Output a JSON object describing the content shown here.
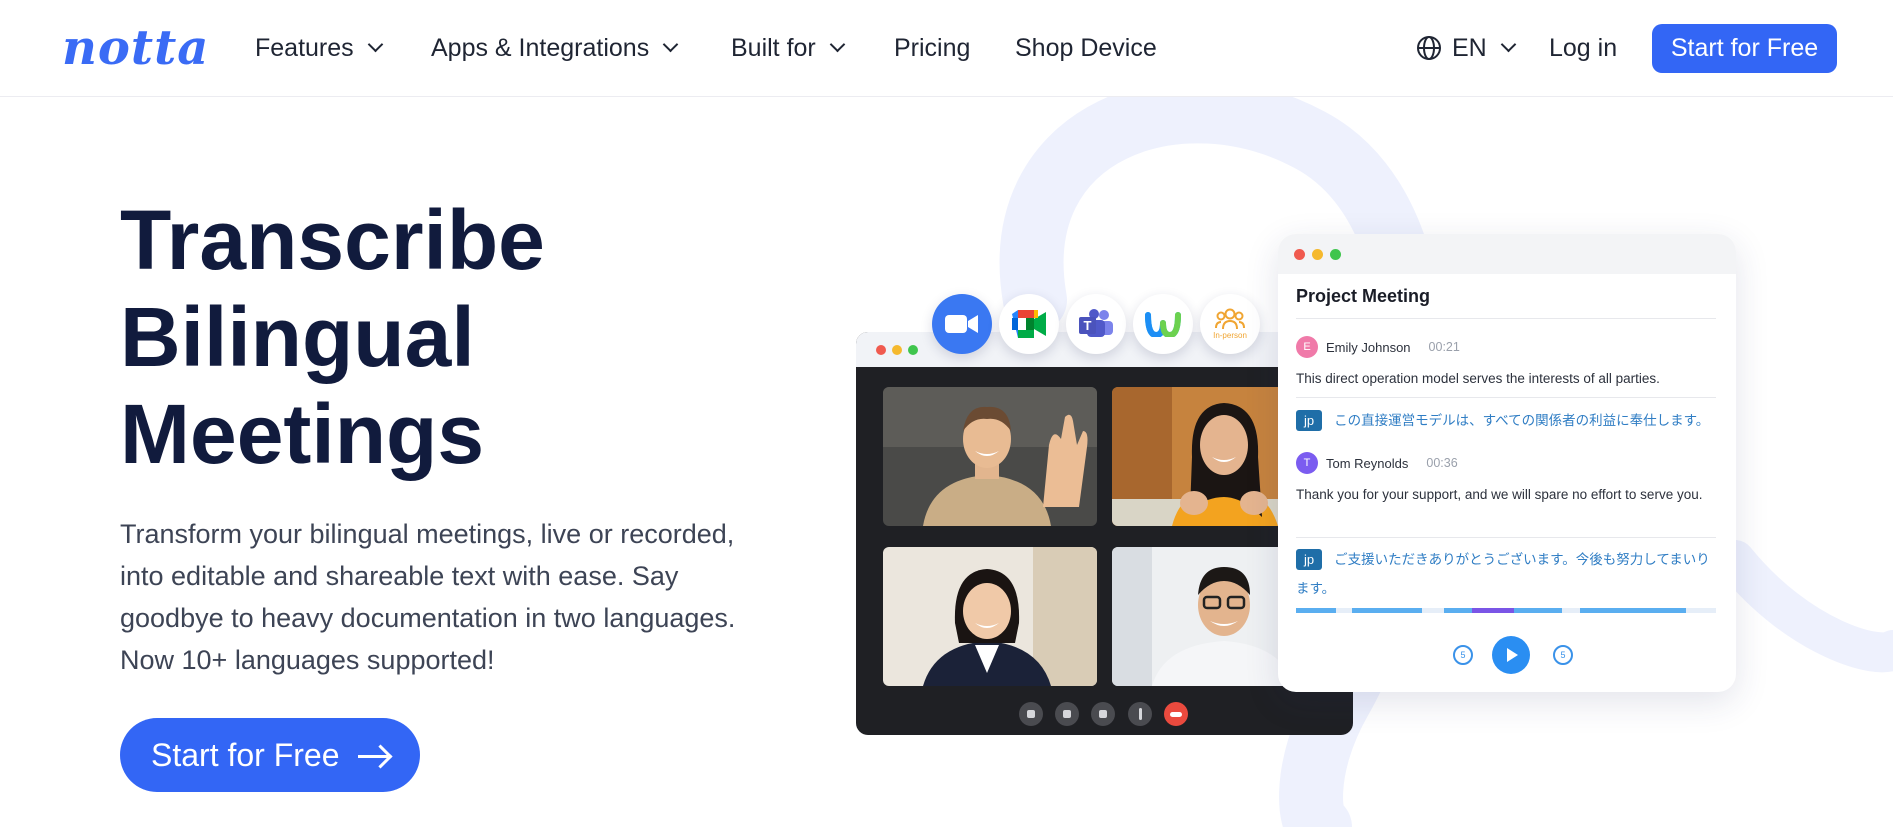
{
  "nav": {
    "logo": "notta",
    "items": [
      {
        "label": "Features",
        "dropdown": true
      },
      {
        "label": "Apps & Integrations",
        "dropdown": true
      },
      {
        "label": "Built for",
        "dropdown": true
      },
      {
        "label": "Pricing",
        "dropdown": false
      },
      {
        "label": "Shop Device",
        "dropdown": false
      }
    ],
    "language": "EN",
    "login": "Log in",
    "cta": "Start for Free"
  },
  "hero": {
    "title_lines": [
      "Transcribe",
      "Bilingual",
      "Meetings"
    ],
    "description": "Transform your bilingual meetings, live or recorded, into editable and shareable text with ease. Say goodbye to heavy documentation in two languages. Now 10+ languages supported!",
    "cta": "Start for Free"
  },
  "integrations": {
    "icons": [
      "zoom-icon",
      "google-meet-icon",
      "microsoft-teams-icon",
      "webex-icon",
      "in-person-icon"
    ],
    "in_person_label": "In-person"
  },
  "transcript": {
    "title": "Project Meeting",
    "entries": [
      {
        "initial": "E",
        "speaker": "Emily Johnson",
        "time": "00:21",
        "text": "This direct operation model serves the interests of all parties.",
        "lang_tag": "jp",
        "translation": "この直接運営モデルは、すべての関係者の利益に奉仕します。"
      },
      {
        "initial": "T",
        "speaker": "Tom Reynolds",
        "time": "00:36",
        "text": "Thank you for your support, and we will spare no effort to serve you.",
        "lang_tag": "jp",
        "translation": "ご支援いただきありがとうございます。今後も努力してまいります。"
      }
    ],
    "skip_back_label": "5",
    "skip_forward_label": "5"
  },
  "colors": {
    "brand": "#3366f5",
    "heading": "#111b3d",
    "emily_avatar": "#f07aa9",
    "tom_avatar": "#7b5cf0",
    "jp_text": "#2f7dc4",
    "play": "#2a8ef2"
  }
}
